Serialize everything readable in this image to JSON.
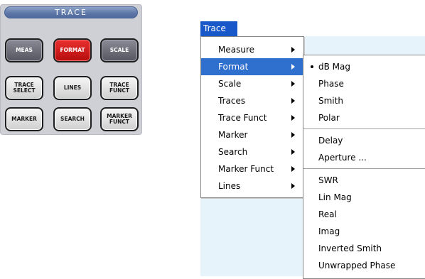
{
  "front_panel": {
    "header": "TRACE",
    "keys": [
      {
        "label": "MEAS",
        "name": "meas-key"
      },
      {
        "label": "FORMAT",
        "name": "format-key"
      },
      {
        "label": "SCALE",
        "name": "scale-key"
      },
      {
        "label": "TRACE\nSELECT",
        "name": "trace-select-key"
      },
      {
        "label": "LINES",
        "name": "lines-key"
      },
      {
        "label": "TRACE\nFUNCT",
        "name": "trace-funct-key"
      },
      {
        "label": "MARKER",
        "name": "marker-key"
      },
      {
        "label": "SEARCH",
        "name": "search-key"
      },
      {
        "label": "MARKER\nFUNCT",
        "name": "marker-funct-key"
      }
    ],
    "colors": {
      "dark_key": "#6b6b76",
      "active_key": "#d01c1c",
      "header": "#5e78a8"
    }
  },
  "menubar": {
    "trace_label": "Trace"
  },
  "trace_menu": {
    "items": [
      "Measure",
      "Format",
      "Scale",
      "Traces",
      "Trace Funct",
      "Marker",
      "Search",
      "Marker Funct",
      "Lines"
    ],
    "active_item": "Format",
    "colors": {
      "menubar_selected": "#1858c8",
      "highlight": "#2f6fce"
    }
  },
  "format_submenu": {
    "selected_item": "dB Mag",
    "groups": [
      [
        "dB Mag",
        "Phase",
        "Smith",
        "Polar"
      ],
      [
        "Delay",
        "Aperture ..."
      ],
      [
        "SWR",
        "Lin Mag",
        "Real",
        "Imag",
        "Inverted Smith",
        "Unwrapped Phase"
      ]
    ]
  }
}
